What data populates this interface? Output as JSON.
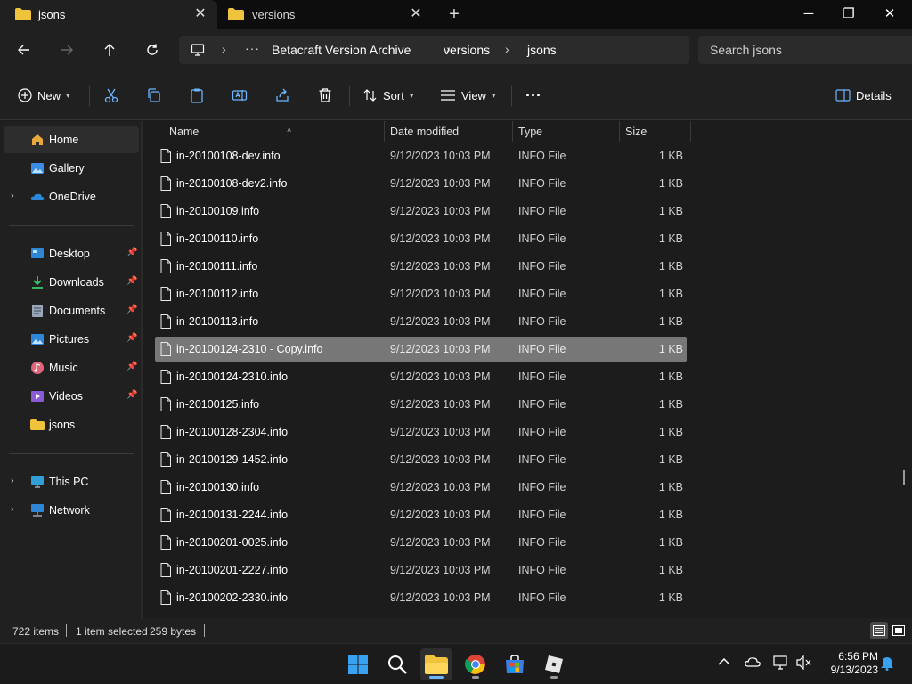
{
  "tabs": [
    {
      "label": "jsons",
      "active": true
    },
    {
      "label": "versions",
      "active": false
    }
  ],
  "window_controls": {
    "minimize": "─",
    "maximize": "❐",
    "close": "✕"
  },
  "address": {
    "overflow": "···",
    "crumbs": [
      "Betacraft Version Archive",
      "versions",
      "jsons"
    ]
  },
  "search": {
    "placeholder": "Search jsons"
  },
  "toolbar": {
    "new_label": "New",
    "sort_label": "Sort",
    "view_label": "View",
    "more_label": "···",
    "details_label": "Details"
  },
  "sidebar": {
    "items": [
      {
        "label": "Home",
        "icon": "home-icon"
      },
      {
        "label": "Gallery",
        "icon": "gallery-icon"
      },
      {
        "label": "OneDrive",
        "icon": "onedrive-icon"
      },
      {
        "label": "Desktop",
        "icon": "desktop-icon"
      },
      {
        "label": "Downloads",
        "icon": "downloads-icon"
      },
      {
        "label": "Documents",
        "icon": "documents-icon"
      },
      {
        "label": "Pictures",
        "icon": "pictures-icon"
      },
      {
        "label": "Music",
        "icon": "music-icon"
      },
      {
        "label": "Videos",
        "icon": "videos-icon"
      },
      {
        "label": "jsons",
        "icon": "folder-icon"
      },
      {
        "label": "This PC",
        "icon": "this-pc-icon"
      },
      {
        "label": "Network",
        "icon": "network-icon"
      }
    ]
  },
  "columns": {
    "name": "Name",
    "date": "Date modified",
    "type": "Type",
    "size": "Size"
  },
  "files": [
    {
      "name": "in-20100108-dev.info",
      "date": "9/12/2023 10:03 PM",
      "type": "INFO File",
      "size": "1 KB"
    },
    {
      "name": "in-20100108-dev2.info",
      "date": "9/12/2023 10:03 PM",
      "type": "INFO File",
      "size": "1 KB"
    },
    {
      "name": "in-20100109.info",
      "date": "9/12/2023 10:03 PM",
      "type": "INFO File",
      "size": "1 KB"
    },
    {
      "name": "in-20100110.info",
      "date": "9/12/2023 10:03 PM",
      "type": "INFO File",
      "size": "1 KB"
    },
    {
      "name": "in-20100111.info",
      "date": "9/12/2023 10:03 PM",
      "type": "INFO File",
      "size": "1 KB"
    },
    {
      "name": "in-20100112.info",
      "date": "9/12/2023 10:03 PM",
      "type": "INFO File",
      "size": "1 KB"
    },
    {
      "name": "in-20100113.info",
      "date": "9/12/2023 10:03 PM",
      "type": "INFO File",
      "size": "1 KB"
    },
    {
      "name": "in-20100124-2310 - Copy.info",
      "date": "9/12/2023 10:03 PM",
      "type": "INFO File",
      "size": "1 KB",
      "selected": true
    },
    {
      "name": "in-20100124-2310.info",
      "date": "9/12/2023 10:03 PM",
      "type": "INFO File",
      "size": "1 KB"
    },
    {
      "name": "in-20100125.info",
      "date": "9/12/2023 10:03 PM",
      "type": "INFO File",
      "size": "1 KB"
    },
    {
      "name": "in-20100128-2304.info",
      "date": "9/12/2023 10:03 PM",
      "type": "INFO File",
      "size": "1 KB"
    },
    {
      "name": "in-20100129-1452.info",
      "date": "9/12/2023 10:03 PM",
      "type": "INFO File",
      "size": "1 KB"
    },
    {
      "name": "in-20100130.info",
      "date": "9/12/2023 10:03 PM",
      "type": "INFO File",
      "size": "1 KB"
    },
    {
      "name": "in-20100131-2244.info",
      "date": "9/12/2023 10:03 PM",
      "type": "INFO File",
      "size": "1 KB"
    },
    {
      "name": "in-20100201-0025.info",
      "date": "9/12/2023 10:03 PM",
      "type": "INFO File",
      "size": "1 KB"
    },
    {
      "name": "in-20100201-2227.info",
      "date": "9/12/2023 10:03 PM",
      "type": "INFO File",
      "size": "1 KB"
    },
    {
      "name": "in-20100202-2330.info",
      "date": "9/12/2023 10:03 PM",
      "type": "INFO File",
      "size": "1 KB"
    }
  ],
  "status": {
    "item_count": "722 items",
    "selection": "1 item selected",
    "selection_size": "259 bytes"
  },
  "taskbar": {
    "apps": [
      "start-icon",
      "search-icon",
      "file-explorer-icon",
      "chrome-icon",
      "store-icon",
      "roblox-icon"
    ],
    "time": "6:56 PM",
    "date": "9/13/2023"
  },
  "colors": {
    "selected_row": "#777777",
    "accent": "#6cb6ff",
    "folder": "#f0c33c"
  }
}
